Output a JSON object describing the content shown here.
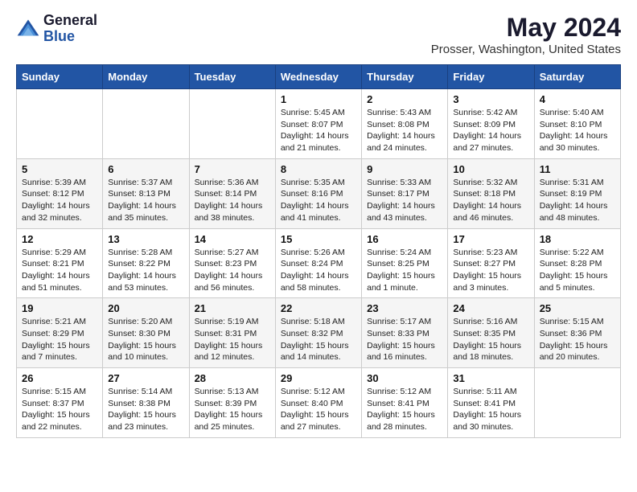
{
  "header": {
    "logo_general": "General",
    "logo_blue": "Blue",
    "title": "May 2024",
    "location": "Prosser, Washington, United States"
  },
  "days_of_week": [
    "Sunday",
    "Monday",
    "Tuesday",
    "Wednesday",
    "Thursday",
    "Friday",
    "Saturday"
  ],
  "weeks": [
    [
      {
        "day": "",
        "info": ""
      },
      {
        "day": "",
        "info": ""
      },
      {
        "day": "",
        "info": ""
      },
      {
        "day": "1",
        "info": "Sunrise: 5:45 AM\nSunset: 8:07 PM\nDaylight: 14 hours\nand 21 minutes."
      },
      {
        "day": "2",
        "info": "Sunrise: 5:43 AM\nSunset: 8:08 PM\nDaylight: 14 hours\nand 24 minutes."
      },
      {
        "day": "3",
        "info": "Sunrise: 5:42 AM\nSunset: 8:09 PM\nDaylight: 14 hours\nand 27 minutes."
      },
      {
        "day": "4",
        "info": "Sunrise: 5:40 AM\nSunset: 8:10 PM\nDaylight: 14 hours\nand 30 minutes."
      }
    ],
    [
      {
        "day": "5",
        "info": "Sunrise: 5:39 AM\nSunset: 8:12 PM\nDaylight: 14 hours\nand 32 minutes."
      },
      {
        "day": "6",
        "info": "Sunrise: 5:37 AM\nSunset: 8:13 PM\nDaylight: 14 hours\nand 35 minutes."
      },
      {
        "day": "7",
        "info": "Sunrise: 5:36 AM\nSunset: 8:14 PM\nDaylight: 14 hours\nand 38 minutes."
      },
      {
        "day": "8",
        "info": "Sunrise: 5:35 AM\nSunset: 8:16 PM\nDaylight: 14 hours\nand 41 minutes."
      },
      {
        "day": "9",
        "info": "Sunrise: 5:33 AM\nSunset: 8:17 PM\nDaylight: 14 hours\nand 43 minutes."
      },
      {
        "day": "10",
        "info": "Sunrise: 5:32 AM\nSunset: 8:18 PM\nDaylight: 14 hours\nand 46 minutes."
      },
      {
        "day": "11",
        "info": "Sunrise: 5:31 AM\nSunset: 8:19 PM\nDaylight: 14 hours\nand 48 minutes."
      }
    ],
    [
      {
        "day": "12",
        "info": "Sunrise: 5:29 AM\nSunset: 8:21 PM\nDaylight: 14 hours\nand 51 minutes."
      },
      {
        "day": "13",
        "info": "Sunrise: 5:28 AM\nSunset: 8:22 PM\nDaylight: 14 hours\nand 53 minutes."
      },
      {
        "day": "14",
        "info": "Sunrise: 5:27 AM\nSunset: 8:23 PM\nDaylight: 14 hours\nand 56 minutes."
      },
      {
        "day": "15",
        "info": "Sunrise: 5:26 AM\nSunset: 8:24 PM\nDaylight: 14 hours\nand 58 minutes."
      },
      {
        "day": "16",
        "info": "Sunrise: 5:24 AM\nSunset: 8:25 PM\nDaylight: 15 hours\nand 1 minute."
      },
      {
        "day": "17",
        "info": "Sunrise: 5:23 AM\nSunset: 8:27 PM\nDaylight: 15 hours\nand 3 minutes."
      },
      {
        "day": "18",
        "info": "Sunrise: 5:22 AM\nSunset: 8:28 PM\nDaylight: 15 hours\nand 5 minutes."
      }
    ],
    [
      {
        "day": "19",
        "info": "Sunrise: 5:21 AM\nSunset: 8:29 PM\nDaylight: 15 hours\nand 7 minutes."
      },
      {
        "day": "20",
        "info": "Sunrise: 5:20 AM\nSunset: 8:30 PM\nDaylight: 15 hours\nand 10 minutes."
      },
      {
        "day": "21",
        "info": "Sunrise: 5:19 AM\nSunset: 8:31 PM\nDaylight: 15 hours\nand 12 minutes."
      },
      {
        "day": "22",
        "info": "Sunrise: 5:18 AM\nSunset: 8:32 PM\nDaylight: 15 hours\nand 14 minutes."
      },
      {
        "day": "23",
        "info": "Sunrise: 5:17 AM\nSunset: 8:33 PM\nDaylight: 15 hours\nand 16 minutes."
      },
      {
        "day": "24",
        "info": "Sunrise: 5:16 AM\nSunset: 8:35 PM\nDaylight: 15 hours\nand 18 minutes."
      },
      {
        "day": "25",
        "info": "Sunrise: 5:15 AM\nSunset: 8:36 PM\nDaylight: 15 hours\nand 20 minutes."
      }
    ],
    [
      {
        "day": "26",
        "info": "Sunrise: 5:15 AM\nSunset: 8:37 PM\nDaylight: 15 hours\nand 22 minutes."
      },
      {
        "day": "27",
        "info": "Sunrise: 5:14 AM\nSunset: 8:38 PM\nDaylight: 15 hours\nand 23 minutes."
      },
      {
        "day": "28",
        "info": "Sunrise: 5:13 AM\nSunset: 8:39 PM\nDaylight: 15 hours\nand 25 minutes."
      },
      {
        "day": "29",
        "info": "Sunrise: 5:12 AM\nSunset: 8:40 PM\nDaylight: 15 hours\nand 27 minutes."
      },
      {
        "day": "30",
        "info": "Sunrise: 5:12 AM\nSunset: 8:41 PM\nDaylight: 15 hours\nand 28 minutes."
      },
      {
        "day": "31",
        "info": "Sunrise: 5:11 AM\nSunset: 8:41 PM\nDaylight: 15 hours\nand 30 minutes."
      },
      {
        "day": "",
        "info": ""
      }
    ]
  ]
}
